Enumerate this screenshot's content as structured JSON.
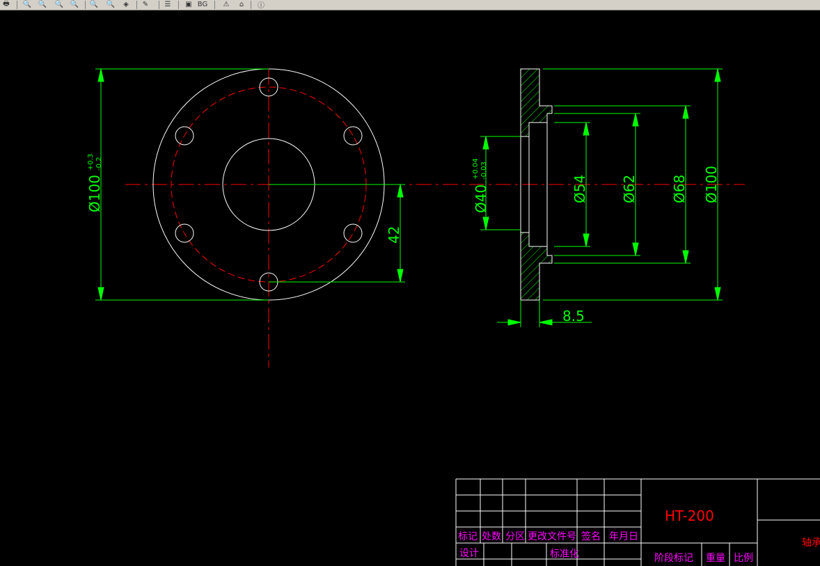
{
  "toolbar": {
    "items": [
      {
        "name": "print-icon",
        "glyph": "🖶"
      },
      {
        "name": "zoom-icon",
        "glyph": "🔍"
      },
      {
        "name": "zoom-in-icon",
        "glyph": "🔍"
      },
      {
        "name": "zoom-window-icon",
        "glyph": "🔍"
      },
      {
        "name": "zoom-realtime-icon",
        "glyph": "🔍"
      },
      {
        "name": "zoom-extents-icon",
        "glyph": "🔍"
      },
      {
        "name": "zoom-previous-icon",
        "glyph": "🔍"
      },
      {
        "name": "layer-icon",
        "glyph": "◈"
      },
      {
        "name": "measure-icon",
        "glyph": "✎"
      },
      {
        "name": "list-icon",
        "glyph": "☰"
      },
      {
        "name": "monitor-icon",
        "glyph": "▣"
      },
      {
        "name": "background-icon",
        "glyph": "BG"
      },
      {
        "name": "warning-icon",
        "glyph": "⚠"
      },
      {
        "name": "home-icon",
        "glyph": "⌂"
      },
      {
        "name": "info-icon",
        "glyph": "ⓘ"
      }
    ]
  },
  "drawing": {
    "dimensions": {
      "front_diameter": "Ø100",
      "front_tol_upper": "+0.3",
      "front_tol_lower": "-0.2",
      "hole_offset": "42",
      "bore": "Ø40",
      "bore_tol_upper": "+0.04",
      "bore_tol_lower": "-0.03",
      "d54": "Ø54",
      "d62": "Ø62",
      "d68": "Ø68",
      "d100": "Ø100",
      "thickness": "8.5"
    },
    "colors": {
      "background": "#000000",
      "outline": "#ffffff",
      "centerline": "#ff0000",
      "dimension": "#00ff00",
      "title_text": "#ff00ff",
      "material_text": "#ff0000"
    }
  },
  "title_block": {
    "material": "HT-200",
    "headers": [
      "标记",
      "处数",
      "分区",
      "更改文件号",
      "签名",
      "年月日"
    ],
    "design": "设计",
    "standardization": "标准化",
    "stage_mark": "阶段标记",
    "weight": "重量",
    "scale": "比例",
    "part_name": "轴承"
  }
}
